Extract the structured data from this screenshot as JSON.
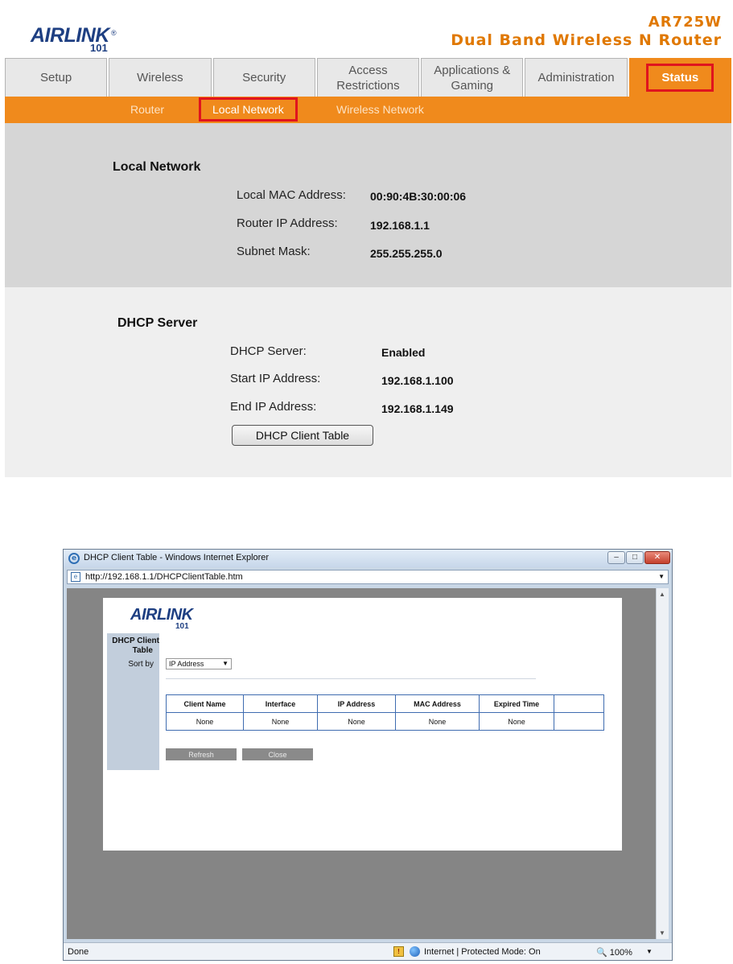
{
  "router": {
    "brand": {
      "word": "AIRLINK",
      "num": "101",
      "reg": "®"
    },
    "model": "AR725W",
    "product": "Dual Band Wireless N Router",
    "tabs": [
      {
        "line1": "Setup",
        "line2": ""
      },
      {
        "line1": "Wireless",
        "line2": ""
      },
      {
        "line1": "Security",
        "line2": ""
      },
      {
        "line1": "Access",
        "line2": "Restrictions"
      },
      {
        "line1": "Applications &",
        "line2": "Gaming"
      },
      {
        "line1": "Administration",
        "line2": ""
      },
      {
        "line1": "Status",
        "line2": ""
      }
    ],
    "subtabs": [
      "Router",
      "Local Network",
      "Wireless Network"
    ],
    "local_network": {
      "heading": "Local Network",
      "rows": [
        {
          "label": "Local MAC Address:",
          "value": "00:90:4B:30:00:06"
        },
        {
          "label": "Router IP Address:",
          "value": "192.168.1.1"
        },
        {
          "label": "Subnet Mask:",
          "value": "255.255.255.0"
        }
      ]
    },
    "dhcp": {
      "heading": "DHCP Server",
      "rows": [
        {
          "label": "DHCP Server:",
          "value": "Enabled"
        },
        {
          "label": "Start IP Address:",
          "value": "192.168.1.100"
        },
        {
          "label": "End IP Address:",
          "value": "192.168.1.149"
        }
      ],
      "button": "DHCP Client Table"
    }
  },
  "popup": {
    "title": "DHCP Client Table - Windows Internet Explorer",
    "url": "http://192.168.1.1/DHCPClientTable.htm",
    "brand": {
      "word": "AIRLINK",
      "num": "101"
    },
    "side_title": [
      "DHCP Client",
      "Table"
    ],
    "sort_label": "Sort by",
    "sort_value": "IP Address",
    "table": {
      "headers": [
        "Client Name",
        "Interface",
        "IP Address",
        "MAC Address",
        "Expired Time",
        ""
      ],
      "rows": [
        [
          "None",
          "None",
          "None",
          "None",
          "None",
          ""
        ]
      ]
    },
    "buttons": {
      "refresh": "Refresh",
      "close": "Close"
    },
    "status": {
      "done": "Done",
      "zone": "Internet | Protected Mode: On",
      "zoom": "100%"
    }
  }
}
